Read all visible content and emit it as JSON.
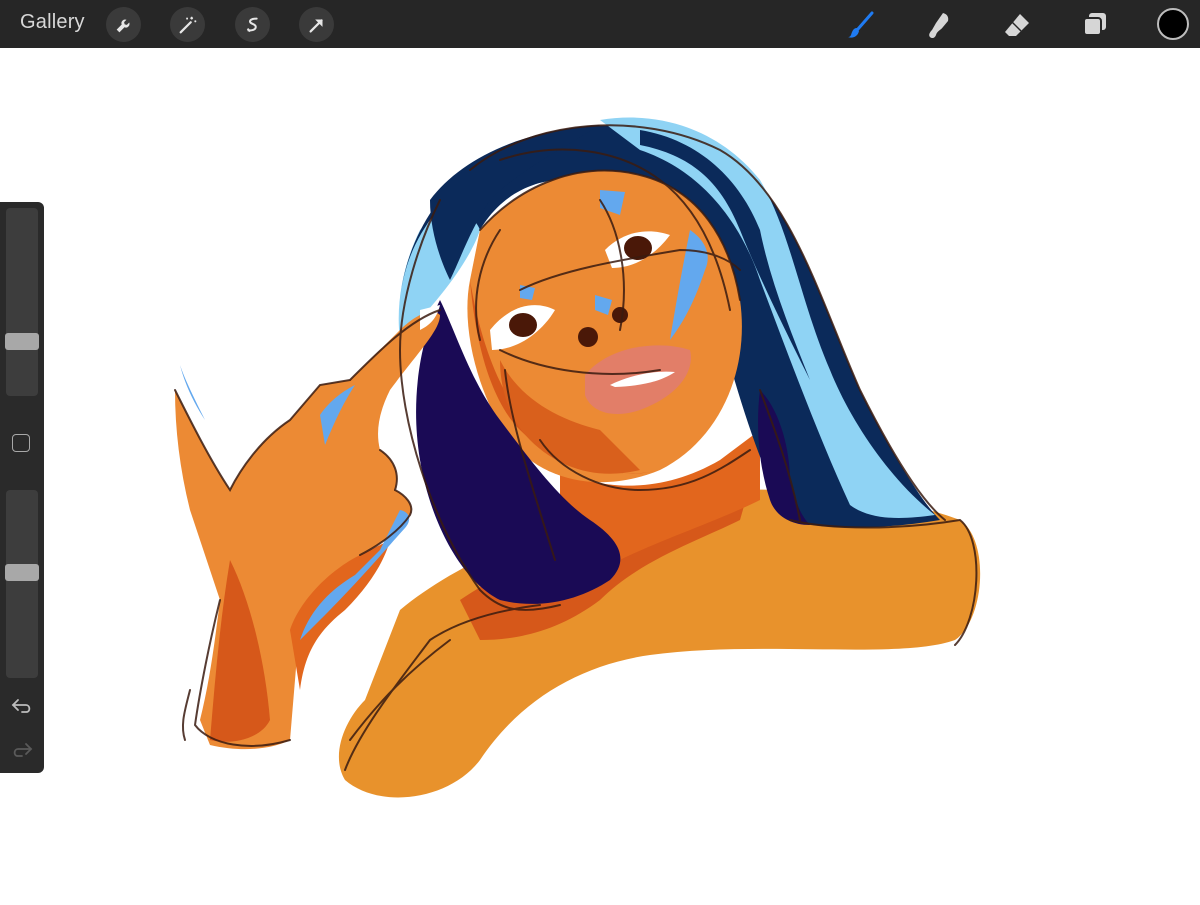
{
  "topbar": {
    "gallery_label": "Gallery",
    "left_tools": [
      "wrench-icon",
      "magic-wand-icon",
      "selection-icon",
      "transform-arrow-icon"
    ],
    "right_tools": [
      "brush-icon",
      "smudge-icon",
      "eraser-icon",
      "layers-icon"
    ],
    "active_tool": "brush-icon",
    "active_color": "#000000"
  },
  "sidebar": {
    "brush_size": 0.27,
    "opacity": 0.57
  },
  "colors": {
    "accent_blue": "#1f7bf2",
    "skin_orange": "#ec8a34",
    "hair_navy": "#0b2a5a",
    "hair_light_blue": "#8fd3f4",
    "hair_purple": "#1a0a55"
  }
}
